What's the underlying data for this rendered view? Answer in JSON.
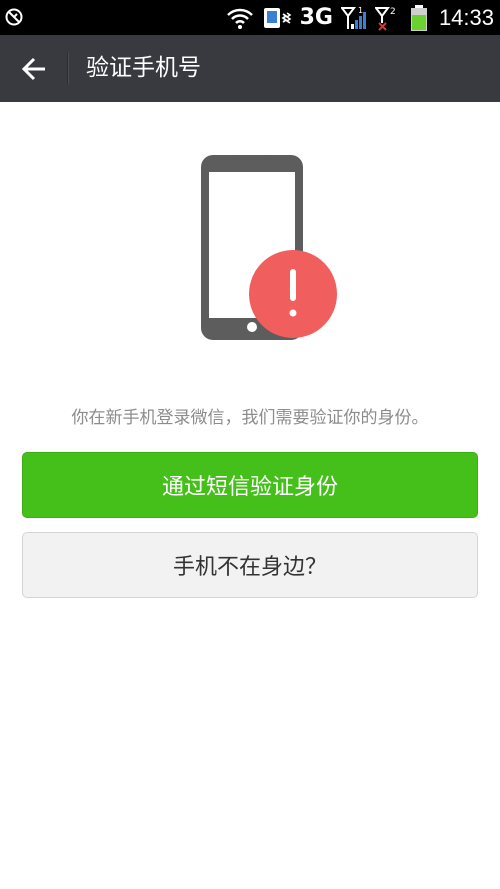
{
  "status_bar": {
    "network_type": "3G",
    "time": "14:33",
    "icons": [
      "no-disturb-icon",
      "wifi-icon",
      "vibrate-icon",
      "signal-sim1-icon",
      "signal-sim2-no-service-icon",
      "battery-charging-icon"
    ]
  },
  "header": {
    "back_icon": "arrow-left-icon",
    "title": "验证手机号"
  },
  "hero": {
    "icon": "phone-alert-icon",
    "alert_color": "#f15e5e",
    "phone_color": "#5d5d5d"
  },
  "main": {
    "hint": "你在新手机登录微信，我们需要验证你的身份。",
    "primary_button": "通过短信验证身份",
    "secondary_button": "手机不在身边？"
  },
  "colors": {
    "primary": "#45c01a",
    "action_bar": "#393a3f"
  }
}
